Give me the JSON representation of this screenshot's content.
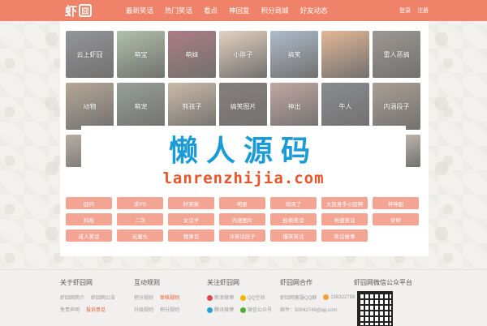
{
  "header": {
    "logo_text": "虾",
    "logo_box": "囧",
    "nav": [
      "最新笑话",
      "热门笑话",
      "看点",
      "神回复",
      "积分商城",
      "好友动态"
    ],
    "login": "登录",
    "register": "注册"
  },
  "tiles": [
    {
      "label": "云上虾囧",
      "color": "#6b6d74"
    },
    {
      "label": "萌宝",
      "color": "#93a98a"
    },
    {
      "label": "萌妹",
      "color": "#8c4b55"
    },
    {
      "label": "小胖子",
      "color": "#d9c0a8"
    },
    {
      "label": "搞笑",
      "color": "#8fa2b8"
    },
    {
      "label": "",
      "color": "#d89b6f"
    },
    {
      "label": "雷人恶搞",
      "color": "#77706a"
    },
    {
      "label": "动物",
      "color": "#9a8670"
    },
    {
      "label": "萌宠",
      "color": "#6f7b74"
    },
    {
      "label": "熊孩子",
      "color": "#b7a186"
    },
    {
      "label": "搞笑图片",
      "color": "#564e4a"
    },
    {
      "label": "神出",
      "color": "#a9857d"
    },
    {
      "label": "牛人",
      "color": "#5c5f66"
    },
    {
      "label": "内涵段子",
      "color": "#8a7a6a"
    },
    {
      "label": "",
      "color": "#9c8e80"
    },
    {
      "label": "",
      "color": "#7c8894"
    },
    {
      "label": "",
      "color": "#b4a89a"
    },
    {
      "label": "",
      "color": "#6e6e6e"
    },
    {
      "label": "",
      "color": "#a39485"
    },
    {
      "label": "",
      "color": "#8a8a8a"
    },
    {
      "label": "",
      "color": "#c4b6a6"
    }
  ],
  "tags": [
    "囧问",
    "求PS",
    "好笑家",
    "明星",
    "萌哭了",
    "大显身手小囧神",
    "神神配",
    "科技",
    "二次",
    "女汉子",
    "内涵图片",
    "经典笑话",
    "奇葩笑话",
    "穿帮",
    "成人笑话",
    "无厘头",
    "糗事百",
    "冷笑话段子",
    "爆笑笑话",
    "笑话故事"
  ],
  "banner": {
    "cn": "懒人源码",
    "en": "lanrenzhijia.com"
  },
  "footer": {
    "col1": {
      "title": "关于虾囧网",
      "rows": [
        [
          "虾囧网简介",
          "虾囧网公告"
        ],
        [
          "免责声明",
          "投诉意见"
        ]
      ]
    },
    "col2": {
      "title": "互动规则",
      "rows": [
        [
          "积分规则",
          "审核规则"
        ],
        [
          "升级规则",
          "积分规则"
        ]
      ]
    },
    "col3": {
      "title": "关注虾囧网",
      "rows": [
        [
          "新浪微博",
          "QQ空间"
        ],
        [
          "腾讯微博",
          "微信公众号"
        ]
      ]
    },
    "col4": {
      "title": "虾囧网合作",
      "rows": [
        [
          "虾囧网客服QQ群",
          "156322789"
        ],
        [
          "邮件：50042748@qq.com"
        ]
      ]
    },
    "col5": {
      "title": "虾囧网微信公众平台"
    }
  }
}
